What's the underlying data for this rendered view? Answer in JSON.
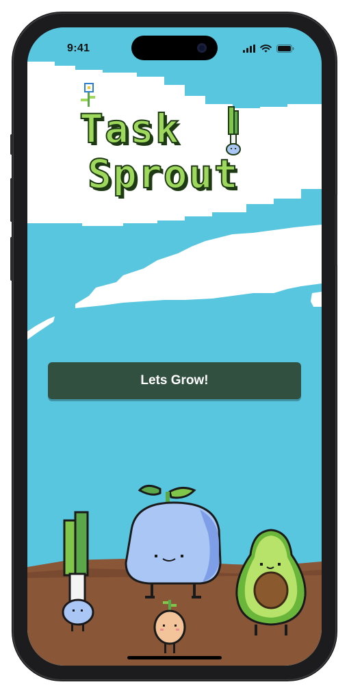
{
  "status_bar": {
    "time": "9:41"
  },
  "app": {
    "title_line1": "Task",
    "title_line2": "Sprout"
  },
  "cta": {
    "label": "Lets Grow!"
  },
  "colors": {
    "sky": "#59c6df",
    "cloud": "#ffffff",
    "ground": "#8a5638",
    "button": "#325040",
    "title_fill": "#9ed85d",
    "title_outline": "#1e3a14"
  },
  "icons": [
    "signal-icon",
    "wifi-icon",
    "battery-icon"
  ],
  "characters": [
    "leek-character",
    "blueberry-blob-character",
    "onion-character",
    "avocado-character",
    "flower-decoration"
  ]
}
